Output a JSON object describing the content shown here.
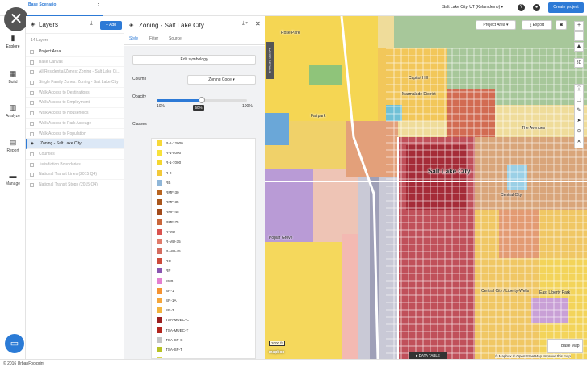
{
  "topbar": {
    "scenario": "Base Scenario",
    "location": "Salt Lake City, UT (Kelan demo)",
    "create_label": "Create project"
  },
  "nav": [
    {
      "label": "Explore",
      "icon": "map-icon"
    },
    {
      "label": "Build",
      "icon": "build-icon"
    },
    {
      "label": "Analyze",
      "icon": "chart-icon"
    },
    {
      "label": "Report",
      "icon": "report-icon"
    },
    {
      "label": "Manage",
      "icon": "folder-icon"
    }
  ],
  "layers": {
    "title": "Layers",
    "add_label": "Add",
    "count": "14 Layers",
    "items": [
      {
        "label": "Project Area",
        "state": "on"
      },
      {
        "label": "Base Canvas",
        "state": "off"
      },
      {
        "label": "All Residential Zones: Zoning - Salt Lake Ci...",
        "state": "off"
      },
      {
        "label": "Single Family Zones: Zoning - Salt Lake City",
        "state": "off"
      },
      {
        "label": "Walk Access to Destinations",
        "state": "off"
      },
      {
        "label": "Walk Access to Employment",
        "state": "off"
      },
      {
        "label": "Walk Access to Households",
        "state": "off"
      },
      {
        "label": "Walk Access to Park Acreage",
        "state": "off"
      },
      {
        "label": "Walk Access to Population",
        "state": "off"
      },
      {
        "label": "Zoning - Salt Lake City",
        "state": "sel"
      },
      {
        "label": "Counties",
        "state": "off"
      },
      {
        "label": "Jurisdiction Boundaries",
        "state": "off"
      },
      {
        "label": "National Transit Lines (2015 Q4)",
        "state": "off"
      },
      {
        "label": "National Transit Stops (2015 Q4)",
        "state": "off"
      }
    ]
  },
  "panel": {
    "title": "Zoning - Salt Lake City",
    "tabs": [
      "Style",
      "Filter",
      "Source"
    ],
    "edit_label": "Edit symbology",
    "column_label": "Column",
    "column_value": "Zoning Code",
    "opacity_label": "Opacity",
    "opacity_value": 0.5,
    "opacity_min": "10%",
    "opacity_tip": "50%",
    "opacity_max": "100%",
    "classes_label": "Classes",
    "classes": [
      {
        "name": "R-1-12000",
        "color": "#f6d83a"
      },
      {
        "name": "R-1-5000",
        "color": "#f7e13c"
      },
      {
        "name": "R-1-7000",
        "color": "#f4d630"
      },
      {
        "name": "R-2",
        "color": "#f2c93a"
      },
      {
        "name": "RB",
        "color": "#8fb6d8"
      },
      {
        "name": "RMF-30",
        "color": "#b8641f"
      },
      {
        "name": "RMF-35",
        "color": "#a9561c"
      },
      {
        "name": "RMF-45",
        "color": "#a24a1a"
      },
      {
        "name": "RMF-75",
        "color": "#c9663a"
      },
      {
        "name": "R-MU",
        "color": "#d9534f"
      },
      {
        "name": "R-MU-35",
        "color": "#e07b6a"
      },
      {
        "name": "R-MU-45",
        "color": "#d46c5f"
      },
      {
        "name": "RO",
        "color": "#cc4a3a"
      },
      {
        "name": "RP",
        "color": "#8a55b0"
      },
      {
        "name": "SNB",
        "color": "#e37fd0"
      },
      {
        "name": "SR-1",
        "color": "#f59331"
      },
      {
        "name": "SR-1A",
        "color": "#f5a63b"
      },
      {
        "name": "SR-3",
        "color": "#f2b43e"
      },
      {
        "name": "TSA-MUEC-C",
        "color": "#9b1f1f"
      },
      {
        "name": "TSA-MUEC-T",
        "color": "#b3261e"
      },
      {
        "name": "TSA-SP-C",
        "color": "#c4c4c4"
      },
      {
        "name": "TSA-SP-T",
        "color": "#b8c224"
      },
      {
        "name": "TSA-UC-C",
        "color": "#d8d84a"
      }
    ]
  },
  "map": {
    "project_area": "Project Area",
    "export": "Export",
    "legend_tab": "LAYER DETAILS",
    "labels": [
      "Rose Park",
      "Capitol Hill",
      "Marmalade District",
      "Fairpark",
      "The Avenues",
      "Salt Lake City",
      "Central City",
      "Poplar Grove",
      "Central City / Liberty-Wells",
      "East Liberty Park"
    ],
    "zoom": "3D",
    "basemap": "Base Map",
    "data_table": "DATA TABLE",
    "attribution": "© Mapbox © OpenStreetMap Improve this map",
    "scale": "2000 ft",
    "logo": "mapbox"
  },
  "footer": "© 2016 UrbanFootprint"
}
